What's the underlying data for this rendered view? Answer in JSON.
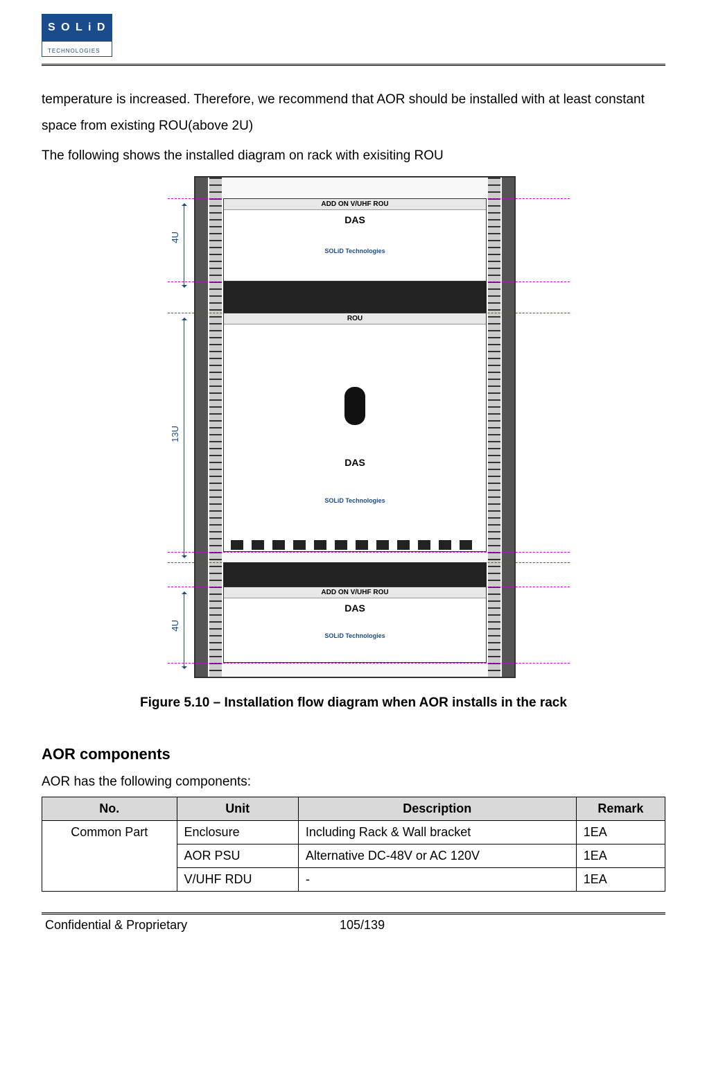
{
  "logo": {
    "brand": "S O L i D",
    "sub": "TECHNOLOGIES"
  },
  "paragraph1": "temperature is increased. Therefore, we recommend that AOR should be installed with at least constant space from existing ROU(above 2U)",
  "paragraph2": "The following shows the installed diagram on rack with exisiting ROU",
  "diagram": {
    "unit1_label": "ADD ON V/UHF ROU",
    "unit2_label": "ROU",
    "unit3_label": "ADD ON V/UHF ROU",
    "das": "DAS",
    "solid": "SOLiD Technologies",
    "dim_top": "4U",
    "dim_mid": "13U",
    "dim_bot": "4U"
  },
  "caption": "Figure 5.10 – Installation flow diagram when AOR installs in the rack",
  "section_heading": "AOR components",
  "section_intro": "AOR has the following components:",
  "table": {
    "headers": [
      "No.",
      "Unit",
      "Description",
      "Remark"
    ],
    "group": "Common Part",
    "rows": [
      {
        "unit": "Enclosure",
        "desc": "Including Rack & Wall bracket",
        "remark": "1EA"
      },
      {
        "unit": "AOR PSU",
        "desc": "Alternative DC-48V or AC 120V",
        "remark": "1EA"
      },
      {
        "unit": "V/UHF RDU",
        "desc": "-",
        "remark": "1EA"
      }
    ]
  },
  "footer": {
    "left": "Confidential & Proprietary",
    "center": "105/139"
  }
}
